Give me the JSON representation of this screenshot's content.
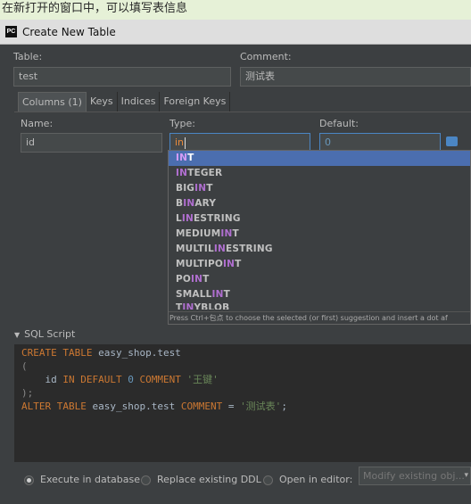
{
  "caption": "在新打开的窗口中，可以填写表信息",
  "window": {
    "icon": "PC",
    "title": "Create New Table"
  },
  "form": {
    "table_label": "Table:",
    "table_value": "test",
    "comment_label": "Comment:",
    "comment_value": "测试表"
  },
  "tabs": [
    "Columns (1)",
    "Keys",
    "Indices",
    "Foreign Keys"
  ],
  "column": {
    "name_label": "Name:",
    "name_value": "id",
    "type_label": "Type:",
    "type_value": "in",
    "default_label": "Default:",
    "default_value": "0"
  },
  "suggestions": [
    {
      "pre": "",
      "hl": "IN",
      "post": "T"
    },
    {
      "pre": "",
      "hl": "IN",
      "post": "TEGER"
    },
    {
      "pre": "BIG",
      "hl": "IN",
      "post": "T"
    },
    {
      "pre": "B",
      "hl": "IN",
      "post": "ARY"
    },
    {
      "pre": "L",
      "hl": "IN",
      "post": "ESTRING"
    },
    {
      "pre": "MEDIUM",
      "hl": "IN",
      "post": "T"
    },
    {
      "pre": "MULTIL",
      "hl": "IN",
      "post": "ESTRING"
    },
    {
      "pre": "MULTIPO",
      "hl": "IN",
      "post": "T"
    },
    {
      "pre": "PO",
      "hl": "IN",
      "post": "T"
    },
    {
      "pre": "SMALL",
      "hl": "IN",
      "post": "T"
    },
    {
      "pre": "T",
      "hl": "IN",
      "post": "YBLOB"
    }
  ],
  "hint": "Press Ctrl+包点 to choose the selected (or first) suggestion and insert a dot af",
  "sql": {
    "header": "SQL Script",
    "lines": [
      [
        {
          "t": "CREATE TABLE ",
          "c": "kw"
        },
        {
          "t": "easy_shop.test",
          "c": ""
        }
      ],
      [
        {
          "t": "(",
          "c": "br"
        }
      ],
      [
        {
          "t": "    id ",
          "c": ""
        },
        {
          "t": "IN DEFAULT ",
          "c": "kw"
        },
        {
          "t": "0 ",
          "c": "num"
        },
        {
          "t": "COMMENT ",
          "c": "kw"
        },
        {
          "t": "'王键'",
          "c": "str"
        }
      ],
      [
        {
          "t": ");",
          "c": "br"
        }
      ],
      [
        {
          "t": "ALTER TABLE ",
          "c": "kw"
        },
        {
          "t": "easy_shop.test ",
          "c": ""
        },
        {
          "t": "COMMENT ",
          "c": "kw"
        },
        {
          "t": "= ",
          "c": ""
        },
        {
          "t": "'测试表'",
          "c": "str"
        },
        {
          "t": ";",
          "c": ""
        }
      ]
    ]
  },
  "bottom": {
    "execute_label": "Execute in database",
    "replace_label": "Replace existing DDL",
    "open_label": "Open in editor:",
    "editor_option": "Modify existing obj..."
  }
}
